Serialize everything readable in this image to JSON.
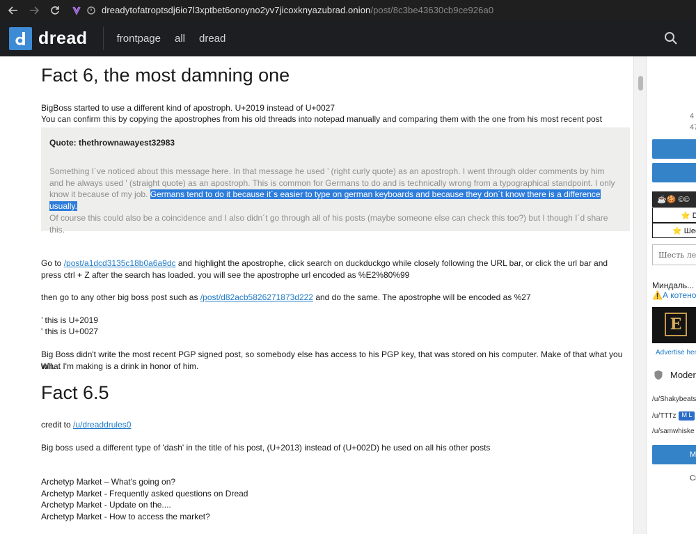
{
  "browser": {
    "url_host": "dreadytofatroptsdj6io7l3xptbet6onoyno2yv7jicoxknyazubrad.onion",
    "url_path": "/post/8c3be43630cb9ce926a0"
  },
  "header": {
    "logo_letter": "d",
    "logo_text": "dread",
    "nav": [
      "frontpage",
      "all",
      "dread"
    ]
  },
  "post": {
    "heading1": "Fact 6, the most damning one",
    "line1": "BigBoss started to use a different kind of apostroph. U+2019 instead of U+0027",
    "line2": "You can confirm this by copying the apostrophes from his old threads into notepad manually and comparing them with the one from his most recent post",
    "quote": {
      "title": "Quote: thethrownawayest32983",
      "body_plain": "Something I´ve noticed about this message here. In that message he used ’ (right curly quote) as an apostroph. I went through older comments by him and he always used ' (straight quote) as an apostroph. This is common for Germans to do and is technically wrong from a typographical standpoint. I only know it because of my job. ",
      "body_highlight": "Germans tend to do it because it´s easier to type on german keyboards and because they don´t know there is a difference usually.",
      "body2": "Of course this could also be a coincidence and I also didn´t go through all of his posts (maybe someone else can check this too?) but I though I´d share this."
    },
    "goto_prefix": "Go to ",
    "goto_link": "/post/a1dcd3135c18b0a6a9dc",
    "goto_suffix": " and highlight the apostrophe, click search on duckduckgo while closely following the URL bar, or click the url bar and press ctrl + Z after the search has loaded. you will see the apostrophe url encoded as %E2%80%99",
    "then_prefix": "then go to any other big boss post such as ",
    "then_link": "/post/d82acb5826271873d222",
    "then_suffix": " and do the same. The apostrophe will be encoded as %27",
    "apos1": "’ this is U+2019",
    "apos2": "' this is U+0027",
    "conclusion1": "Big Boss didn't write the most recent PGP signed post, so somebody else has access to his PGP key, that was stored on his computer. Make of that what you will.",
    "conclusion2": "What I'm making is a drink in honor of him.",
    "heading2": "Fact 6.5",
    "credit_prefix": "credit to ",
    "credit_link": "/u/dreaddrules0",
    "dash_line": "Big boss used a different type of 'dash' in the title of his post, (U+2013) instead of (U+002D) he used on all his other posts",
    "titles": [
      "Archetyp Market – What's going on?",
      "Archetyp Market - Frequently asked questions on Dread",
      "Archetyp Market - Update on the....",
      "Archetyp Market - How to access the market?"
    ]
  },
  "sidebar": {
    "num1": "4",
    "num2": "47",
    "box1": "☕🍪 ©©",
    "box2": "⭐ D",
    "box3": "⭐ Шес",
    "input_placeholder": "Шесть ле",
    "text1": "Миндаль...",
    "text2": "⚠️А котенок",
    "ad_letter": "E",
    "advertise": "Advertise her",
    "mods_label": "Moder",
    "users": [
      "/u/Shakybeats",
      "/u/TTTz",
      "/u/samwhiske"
    ],
    "badge": "M L",
    "btn_text": "M",
    "bottom": "Cr"
  },
  "colors": {
    "accent": "#3d8bd4",
    "link": "#1f7ac7",
    "highlight": "#2f7ddb",
    "header_bg": "#1c1e22"
  }
}
